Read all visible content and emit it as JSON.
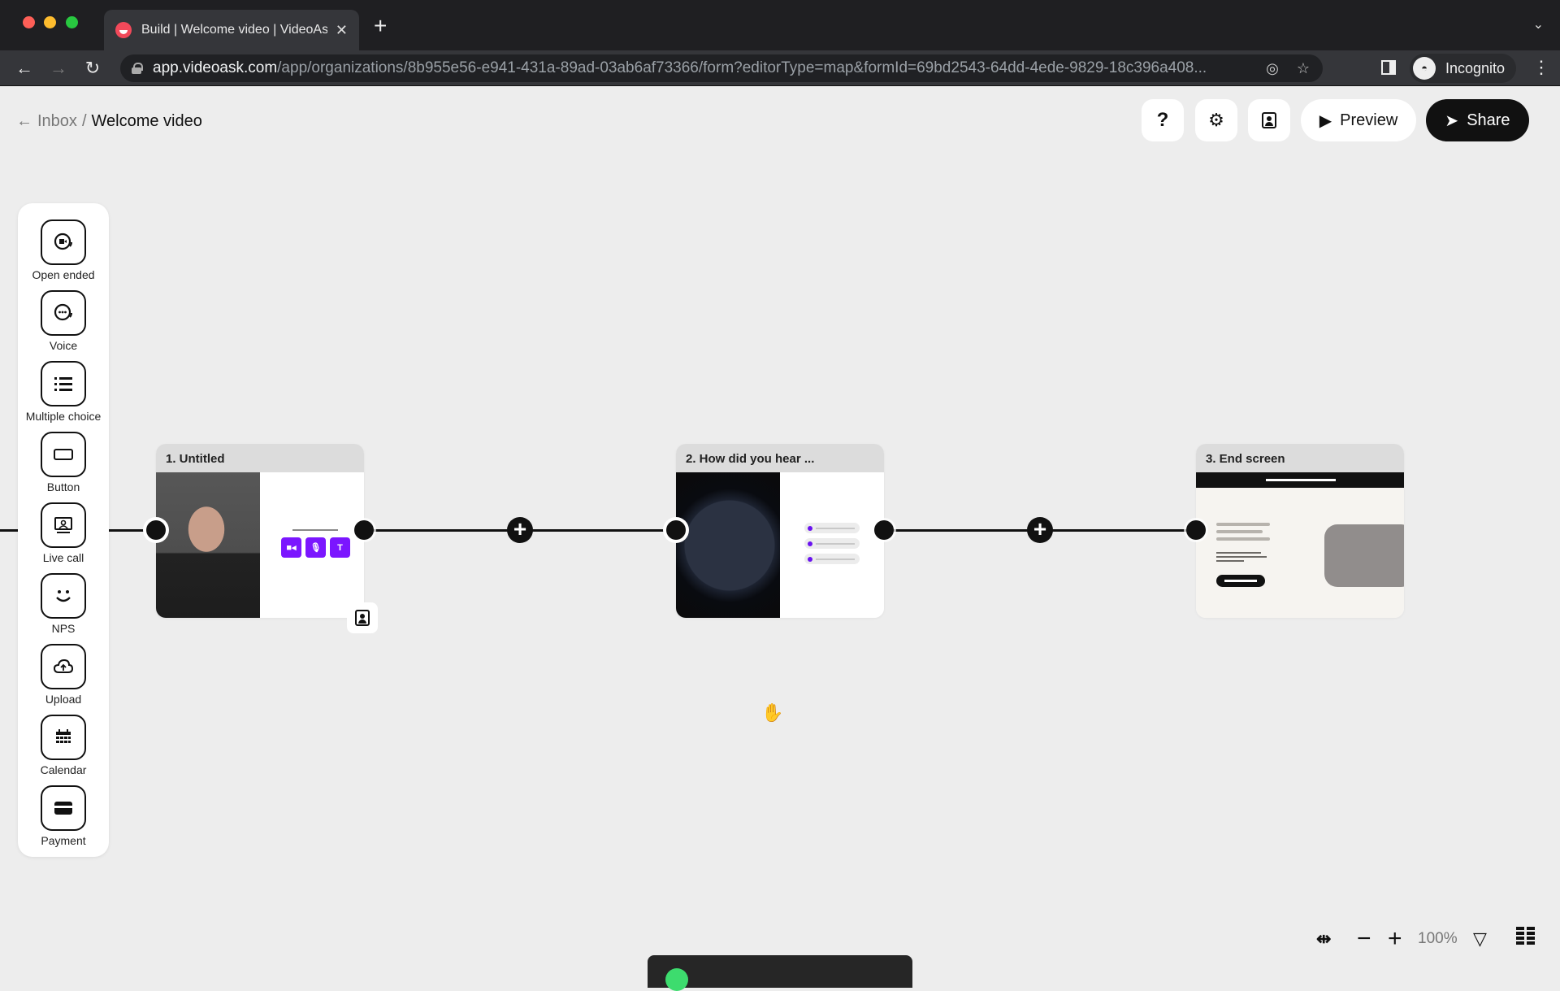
{
  "browser": {
    "tab_title": "Build | Welcome video | VideoAsk",
    "new_tab_symbol": "+",
    "url_host": "app.videoask.com",
    "url_path": "/app/organizations/8b955e56-e941-431a-89ad-03ab6af73366/form?editorType=map&formId=69bd2543-64dd-4ede-9829-18c396a408...",
    "profile_label": "Incognito",
    "icons": [
      "back-icon",
      "forward-icon",
      "reload-icon",
      "lock-icon",
      "eye-off-icon",
      "star-icon",
      "side-panel-icon",
      "incognito-icon",
      "kebab-menu-icon"
    ]
  },
  "header": {
    "breadcrumb": {
      "back_arrow": "←",
      "parent": "Inbox",
      "separator": "/",
      "current": "Welcome video"
    },
    "buttons": {
      "help": "?",
      "settings": "⚙",
      "preview": "Preview",
      "share": "Share"
    }
  },
  "palette": {
    "items": [
      {
        "label": "Open ended",
        "icon": "video-chat-icon"
      },
      {
        "label": "Voice",
        "icon": "voice-chat-icon"
      },
      {
        "label": "Multiple choice",
        "icon": "list-icon"
      },
      {
        "label": "Button",
        "icon": "button-icon"
      },
      {
        "label": "Live call",
        "icon": "live-call-icon"
      },
      {
        "label": "NPS",
        "icon": "smiley-icon"
      },
      {
        "label": "Upload",
        "icon": "cloud-upload-icon"
      },
      {
        "label": "Calendar",
        "icon": "calendar-icon"
      },
      {
        "label": "Payment",
        "icon": "credit-card-icon"
      }
    ]
  },
  "canvas": {
    "steps": [
      {
        "title": "1. Untitled",
        "type": "open-ended",
        "response_options": [
          "video",
          "audio",
          "text"
        ]
      },
      {
        "title": "2. How did you hear ...",
        "type": "multiple-choice",
        "option_count": 3
      },
      {
        "title": "3. End screen",
        "type": "end-screen"
      }
    ],
    "add_symbol": "+",
    "accent_color": "#7b16ff"
  },
  "zoom_controls": {
    "level": "100%",
    "minus": "−",
    "plus": "+"
  }
}
